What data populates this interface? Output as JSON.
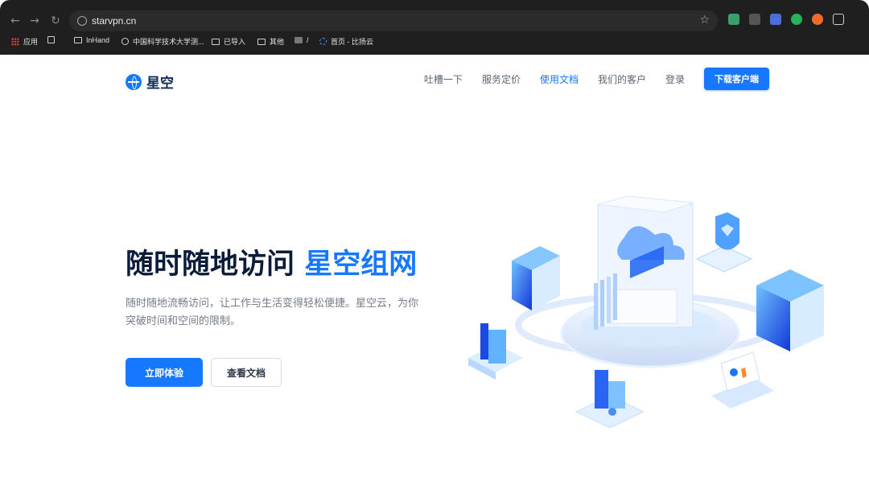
{
  "browser": {
    "url": "starvpn.cn",
    "bookmarks": [
      "应用",
      "InHand",
      "中国科学技术大学测...",
      "已导入",
      "其他",
      "/",
      "首页 - 比扬云"
    ]
  },
  "site": {
    "logo_text": "星空",
    "nav": [
      "吐槽一下",
      "服务定价",
      "使用文档",
      "我们的客户",
      "登录"
    ],
    "download": "下载客户端"
  },
  "hero": {
    "title_main": "随时随地访问",
    "title_accent": "星空组网",
    "description": "随时随地流畅访问，让工作与生活变得轻松便捷。星空云，为你突破时间和空间的限制。",
    "primary_button": "立即体验",
    "secondary_button": "查看文档"
  },
  "colors": {
    "brand": "#1677ff",
    "dark_text": "#0b1b3a",
    "browser_chrome": "#1f1f1f"
  }
}
